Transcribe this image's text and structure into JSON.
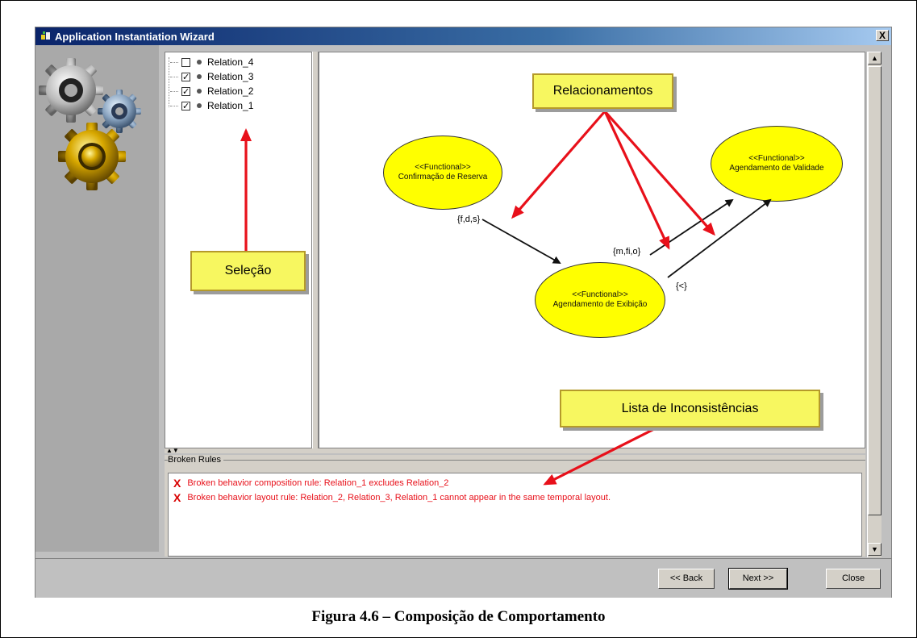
{
  "window": {
    "title": "Application Instantiation Wizard",
    "close_glyph": "X"
  },
  "tree": {
    "items": [
      {
        "label": "Relation_4",
        "checked": false,
        "check": ""
      },
      {
        "label": "Relation_3",
        "checked": true,
        "check": "✓"
      },
      {
        "label": "Relation_2",
        "checked": true,
        "check": "✓"
      },
      {
        "label": "Relation_1",
        "checked": true,
        "check": "✓"
      }
    ]
  },
  "diagram": {
    "nodes": [
      {
        "stereotype": "<<Functional>>",
        "name": "Confirmação de Reserva"
      },
      {
        "stereotype": "<<Functional>>",
        "name": "Agendamento de Validade"
      },
      {
        "stereotype": "<<Functional>>",
        "name": "Agendamento de Exibição"
      }
    ],
    "edge_labels": [
      "{f,d,s}",
      "{m,fi,o}",
      "{<}"
    ]
  },
  "callouts": {
    "relacionamentos": "Relacionamentos",
    "selecao": "Seleção",
    "inconsistencias": "Lista de Inconsistências"
  },
  "broken_rules": {
    "legend": "Broken Rules",
    "icon_glyph": "X",
    "items": [
      "Broken behavior composition rule: Relation_1  excludes  Relation_2",
      "Broken behavior layout rule: Relation_2, Relation_3, Relation_1 cannot appear in the same temporal layout."
    ]
  },
  "buttons": {
    "back": "<< Back",
    "next": "Next >>",
    "close": "Close"
  },
  "caption": "Figura 4.6 – Composição de Comportamento",
  "colors": {
    "ellipse_fill": "#ffff00",
    "callout_fill": "#f7f760",
    "arrow_red": "#e8101a",
    "error_text": "#e8101a"
  }
}
